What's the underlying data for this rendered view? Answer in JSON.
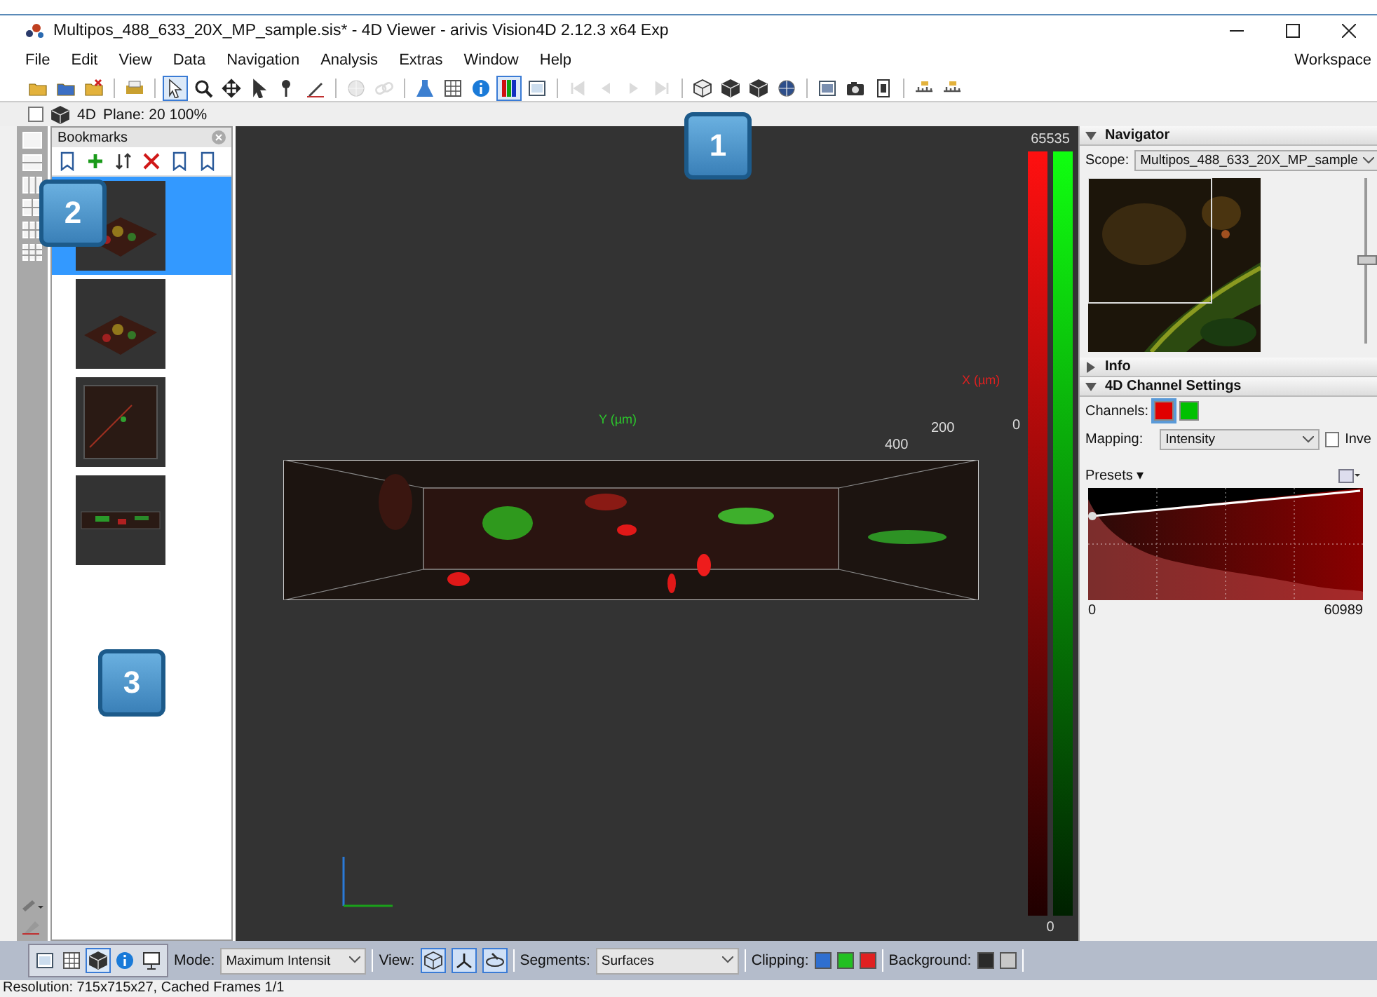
{
  "window": {
    "title": "Multipos_488_633_20X_MP_sample.sis* - 4D Viewer - arivis Vision4D 2.12.3 x64 Exp"
  },
  "menu": [
    "File",
    "Edit",
    "View",
    "Data",
    "Navigation",
    "Analysis",
    "Extras",
    "Window",
    "Help"
  ],
  "workspace": "Workspace",
  "toolbar": [
    [
      {
        "kind": "folder",
        "selected": false,
        "disabled": false
      },
      {
        "kind": "save",
        "selected": false,
        "disabled": false
      },
      {
        "kind": "folder-x",
        "selected": false,
        "disabled": false
      }
    ],
    [
      {
        "kind": "printer",
        "selected": false,
        "disabled": false
      }
    ],
    [
      {
        "kind": "pointer",
        "selected": true,
        "disabled": false
      },
      {
        "kind": "search",
        "selected": false,
        "disabled": false
      },
      {
        "kind": "move",
        "selected": false,
        "disabled": false
      },
      {
        "kind": "arrow",
        "selected": false,
        "disabled": false
      },
      {
        "kind": "pin",
        "selected": false,
        "disabled": false
      },
      {
        "kind": "pen",
        "selected": false,
        "disabled": false
      }
    ],
    [
      {
        "kind": "sphere",
        "selected": false,
        "disabled": true
      },
      {
        "kind": "link",
        "selected": false,
        "disabled": true
      }
    ],
    [
      {
        "kind": "flask",
        "selected": false,
        "disabled": false
      },
      {
        "kind": "table",
        "selected": false,
        "disabled": false
      },
      {
        "kind": "info",
        "selected": false,
        "disabled": false
      },
      {
        "kind": "channels",
        "selected": true,
        "disabled": false
      },
      {
        "kind": "panel",
        "selected": false,
        "disabled": false
      }
    ],
    [
      {
        "kind": "first",
        "selected": false,
        "disabled": true
      },
      {
        "kind": "previous",
        "selected": false,
        "disabled": true
      },
      {
        "kind": "next",
        "selected": false,
        "disabled": true
      },
      {
        "kind": "last",
        "selected": false,
        "disabled": true
      }
    ],
    [
      {
        "kind": "box",
        "selected": false,
        "disabled": false
      },
      {
        "kind": "cube",
        "selected": false,
        "disabled": false
      },
      {
        "kind": "cube",
        "selected": false,
        "disabled": false
      },
      {
        "kind": "globe",
        "selected": false,
        "disabled": false
      }
    ],
    [
      {
        "kind": "document",
        "selected": false,
        "disabled": false
      },
      {
        "kind": "camera",
        "selected": false,
        "disabled": false
      },
      {
        "kind": "film",
        "selected": false,
        "disabled": false
      }
    ],
    [
      {
        "kind": "ruler",
        "selected": false,
        "disabled": false
      },
      {
        "kind": "ruler",
        "selected": false,
        "disabled": false
      }
    ]
  ],
  "viewer_header": {
    "checked": false,
    "mode": "4D",
    "plane": "Plane: 20 100%"
  },
  "bookmarks": {
    "title": "Bookmarks",
    "tools": [
      {
        "kind": "bookmark"
      },
      {
        "kind": "plus"
      },
      {
        "kind": "sort"
      },
      {
        "kind": "delete"
      },
      {
        "kind": "bookmark"
      },
      {
        "kind": "bookmark"
      }
    ],
    "items": [
      {
        "selected": true
      },
      {
        "selected": false
      },
      {
        "selected": false
      },
      {
        "selected": false
      }
    ]
  },
  "viewport": {
    "y_axis": "Y (µm)",
    "x_axis": "X (µm)",
    "tick_labels": [
      "200",
      "400",
      "0"
    ],
    "colorbar_max": "65535",
    "colorbar_min": "0"
  },
  "navigator": {
    "title": "Navigator",
    "expanded": true,
    "scope_label": "Scope:",
    "scope": "Multipos_488_633_20X_MP_sample",
    "zoom_slider": {
      "level": 0.5
    }
  },
  "info": {
    "title": "Info",
    "expanded": false
  },
  "channel_settings": {
    "title": "4D Channel Settings",
    "expanded": true,
    "channels_label": "Channels:",
    "channels": [
      {
        "color": "#e00000",
        "selected": true
      },
      {
        "color": "#00c000",
        "selected": false
      }
    ],
    "mapping_label": "Mapping:",
    "mapping": "Intensity",
    "invert_label": "Inve",
    "invert_checked": false,
    "presets": "Presets ▾",
    "hist_min": "0",
    "hist_max": "60989"
  },
  "bottom_bar": {
    "view_buttons": [
      {
        "kind": "single",
        "selected": false
      },
      {
        "kind": "grid",
        "selected": false
      },
      {
        "kind": "cube",
        "selected": true
      },
      {
        "kind": "info",
        "selected": false
      },
      {
        "kind": "presentation",
        "selected": false
      }
    ],
    "mode_label": "Mode:",
    "mode": "Maximum Intensit",
    "view_label": "View:",
    "view_tools": [
      {
        "kind": "rotate",
        "selected": true
      },
      {
        "kind": "axes",
        "selected": true
      },
      {
        "kind": "orbit",
        "selected": true
      }
    ],
    "segments_label": "Segments:",
    "segments": "Surfaces",
    "clipping_label": "Clipping:",
    "clipping": [
      {
        "color": "#2f6fd0"
      },
      {
        "color": "#22c022"
      },
      {
        "color": "#e02020"
      }
    ],
    "background_label": "Background:",
    "backgrounds": [
      {
        "color": "#2a2a2a"
      },
      {
        "color": "#c8c8c8"
      }
    ]
  },
  "status_bar": "Resolution: 715x715x27, Cached Frames 1/1",
  "callouts": [
    "1",
    "2",
    "3"
  ]
}
